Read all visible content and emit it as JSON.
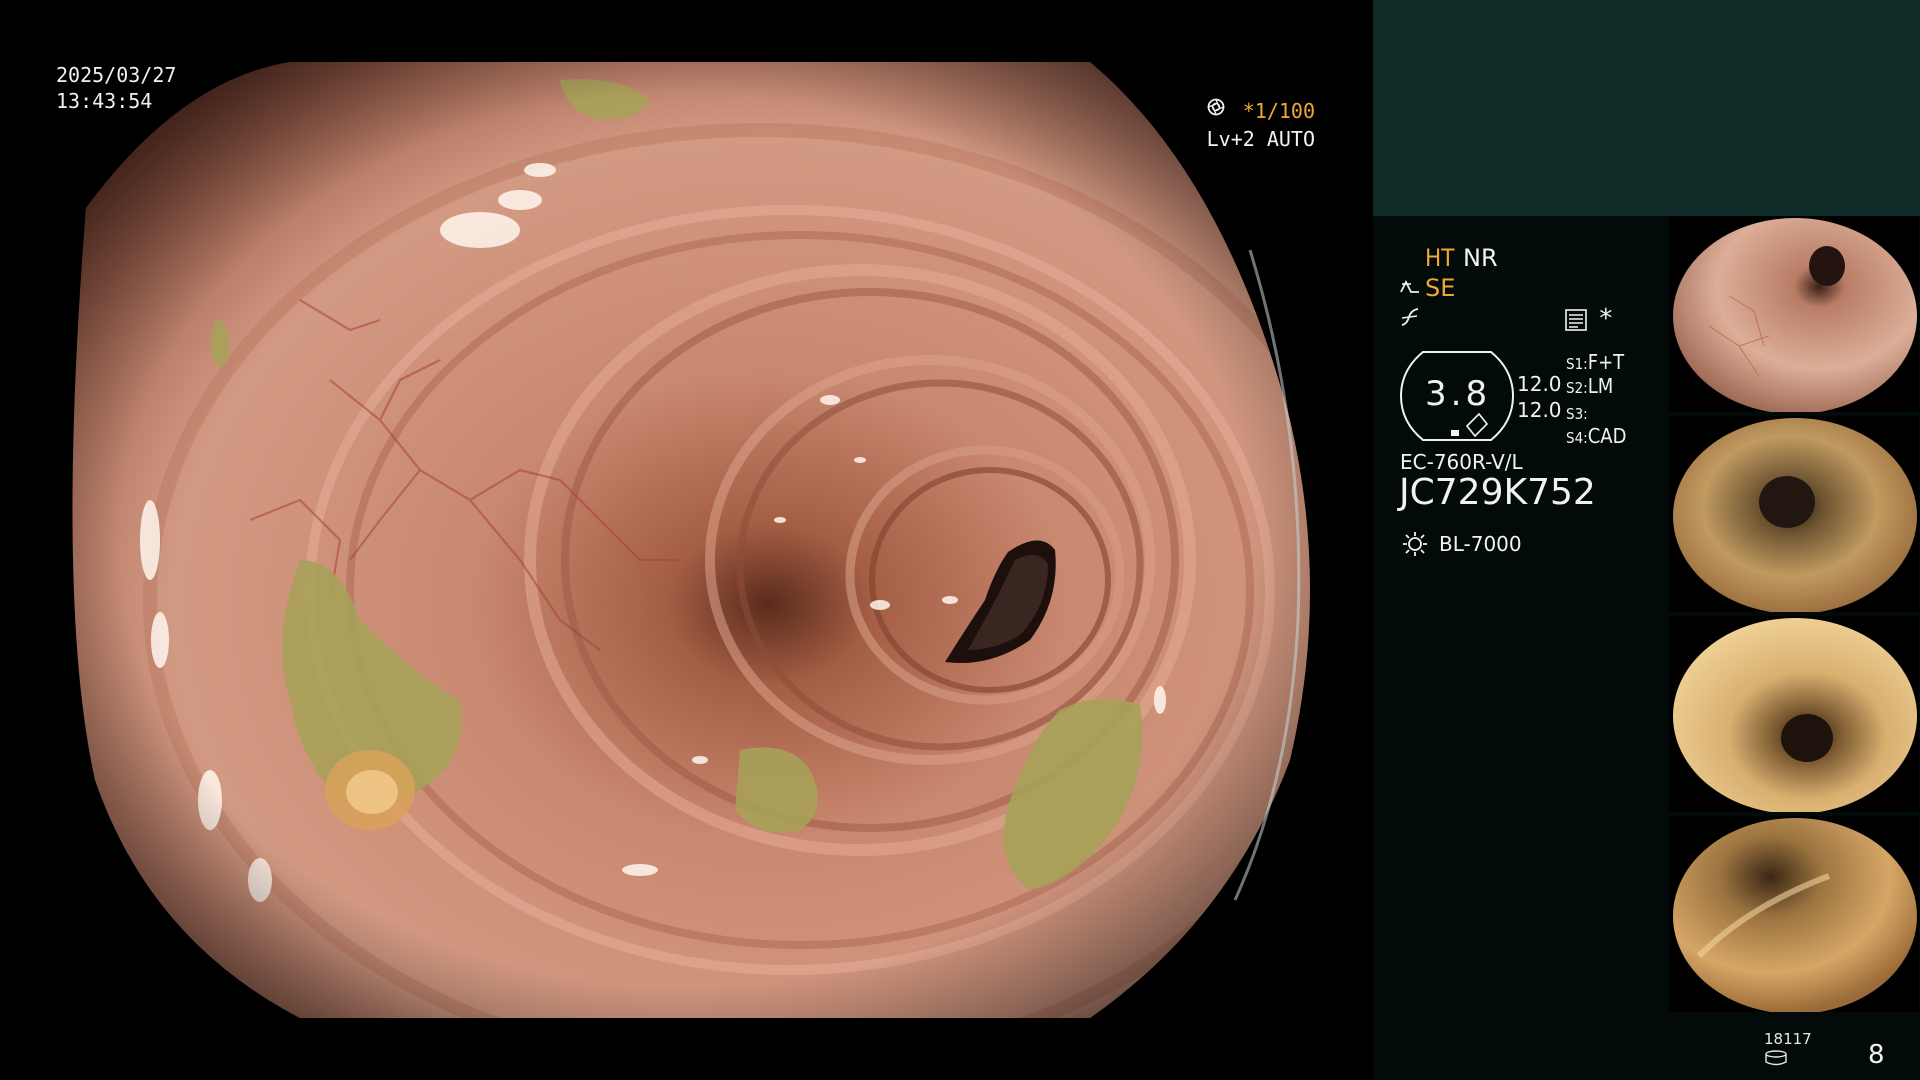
{
  "endoscopy_view": {
    "date": "2025/03/27",
    "time": "13:43:54",
    "shutter_speed": "*1/100",
    "shutter_icon": "aperture-icon",
    "exposure_level": "Lv+2",
    "exposure_mode": "AUTO",
    "exposure_icon": "iris-icon"
  },
  "image_settings": {
    "ht_label": "HT",
    "nr_label": "NR",
    "se_label": "SE",
    "se_icon": "enhancement-icon",
    "curve_icon": "tone-curve-icon",
    "doc_icon": "report-icon",
    "asterisk": "*"
  },
  "magnification": {
    "value": "3.8",
    "zoom_1": "12.0",
    "zoom_2": "12.0"
  },
  "switches": [
    {
      "key": "S1",
      "value": "F+T"
    },
    {
      "key": "S2",
      "value": "LM"
    },
    {
      "key": "S3",
      "value": ""
    },
    {
      "key": "S4",
      "value": "CAD"
    }
  ],
  "scope": {
    "model": "EC-760R-V/L",
    "serial": "JC729K752"
  },
  "light_source": {
    "icon": "lamp-icon",
    "model": "BL-7000"
  },
  "thumbnails": [
    {
      "name": "capture-1"
    },
    {
      "name": "capture-2"
    },
    {
      "name": "capture-3"
    },
    {
      "name": "capture-4"
    }
  ],
  "storage": {
    "count": "18117",
    "icon": "storage-icon",
    "images_captured": "8"
  },
  "colors": {
    "accent_orange": "#f0a830",
    "panel_teal": "#0f2b28",
    "panel_dark": "#020b0a"
  }
}
